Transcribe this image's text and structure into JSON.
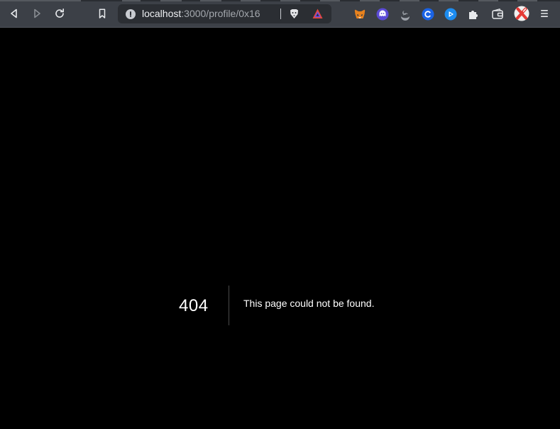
{
  "browser": {
    "url_host": "localhost",
    "url_rest": ":3000/profile/0x16",
    "icons": {
      "back": "back-arrow-icon",
      "forward": "forward-arrow-icon",
      "reload": "reload-icon",
      "bookmark": "bookmark-icon",
      "site_info": "info-icon",
      "brave_shields": "brave-lion-icon",
      "brave_rewards": "brave-rewards-triangle-icon",
      "extensions": [
        "metamask-fox-icon",
        "purple-ghost-icon",
        "sleep-moon-icon",
        "blue-c-icon",
        "blue-play-icon",
        "puzzle-icon",
        "wallet-icon",
        "profile-avatar-icon",
        "menu-icon"
      ]
    },
    "colors": {
      "toolbar_bg": "#3c4047",
      "urlbar_bg": "#2b2e33",
      "url_host_color": "#eef0f3",
      "url_rest_color": "#a4a8ae",
      "page_bg": "#000000"
    }
  },
  "page": {
    "error_code": "404",
    "error_message": "This page could not be found."
  }
}
